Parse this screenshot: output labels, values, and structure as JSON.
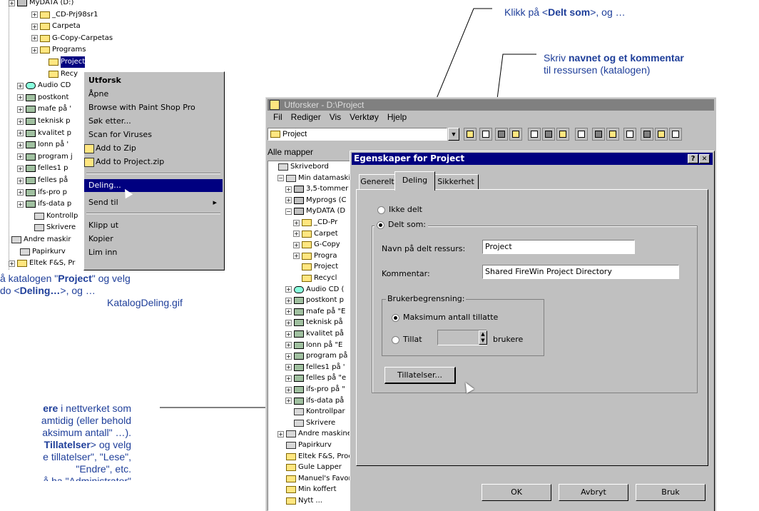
{
  "top_tree": {
    "items": [
      {
        "label": "MyDATA (D:)",
        "kind": "drv"
      },
      {
        "label": "_CD-Prj98sr1",
        "kind": "fold"
      },
      {
        "label": "Carpeta",
        "kind": "fold"
      },
      {
        "label": "G-Copy-Carpetas",
        "kind": "fold"
      },
      {
        "label": "Programs",
        "kind": "fold"
      },
      {
        "label": "Project",
        "kind": "fold"
      },
      {
        "label": "Recy",
        "kind": "fold"
      },
      {
        "label": "Audio CD",
        "kind": "cd"
      },
      {
        "label": "postkont",
        "kind": "net"
      },
      {
        "label": "mafe på '",
        "kind": "net"
      },
      {
        "label": "teknisk p",
        "kind": "net"
      },
      {
        "label": "kvalitet p",
        "kind": "net"
      },
      {
        "label": "lonn på '",
        "kind": "net"
      },
      {
        "label": "program j",
        "kind": "net"
      },
      {
        "label": "felles1 p",
        "kind": "net"
      },
      {
        "label": "felles på",
        "kind": "net"
      },
      {
        "label": "ifs-pro p",
        "kind": "net"
      },
      {
        "label": "ifs-data p",
        "kind": "net"
      },
      {
        "label": "Kontrollp",
        "kind": "pc"
      },
      {
        "label": "Skrivere",
        "kind": "pc"
      },
      {
        "label": "Andre maskir",
        "kind": "pc"
      },
      {
        "label": "Papirkurv",
        "kind": "pc"
      },
      {
        "label": "Eltek F&S, Pr",
        "kind": "fold"
      }
    ]
  },
  "context_menu": {
    "items": [
      {
        "label": "Utforsk",
        "bold": true
      },
      {
        "label": "Åpne"
      },
      {
        "label": "Browse with Paint Shop Pro"
      },
      {
        "label": "Søk etter..."
      },
      {
        "label": "Scan for Viruses"
      },
      {
        "label": "Add to Zip"
      },
      {
        "label": "Add to Project.zip"
      },
      {
        "label": "Deling...",
        "highlight": true
      },
      {
        "label": "Send til",
        "submenu": true
      },
      {
        "label": "Klipp ut"
      },
      {
        "label": "Kopier"
      },
      {
        "label": "Lim inn"
      }
    ],
    "submenu_arrow": "▸"
  },
  "annotations": {
    "a1_line1_pre": "å katalogen \"",
    "a1_line1_bold": "Project",
    "a1_line1_post": "\" og velg",
    "a1_line2_pre": "do <",
    "a1_line2_bold": "Deling…",
    "a1_line2_post": ">, og …",
    "a1_file": "KatalogDeling.gif",
    "a2_line1_bold": "ere",
    "a2_line1_post": " i nettverket som",
    "a2_line2": "amtidig (eller behold",
    "a2_line3": "aksimum antall\" …).",
    "a2_line4_bold": "Tillatelser",
    "a2_line4_post": "> og velg",
    "a2_line5": "e tillatelser\", \"Lese\",",
    "a2_line6": "\"Endre\", etc.",
    "a2_line7": "å ha \"Administrator\"",
    "top_right_pre": "Klikk på <",
    "top_right_bold": "Delt som",
    "top_right_post": ">, og …",
    "right_line1_pre": "Skriv ",
    "right_line1_bold": "navnet og et kommentar",
    "right_line2": "til ressursen (katalogen)"
  },
  "explorer": {
    "title": "Utforsker - D:\\Project",
    "menu": [
      "Fil",
      "Rediger",
      "Vis",
      "Verktøy",
      "Hjelp"
    ],
    "address": "Project",
    "tree_header": "Alle mapper",
    "tree": [
      {
        "label": "Skrivebord",
        "kind": "pc",
        "indent": 0
      },
      {
        "label": "Min datamaskin",
        "kind": "pc",
        "indent": 1
      },
      {
        "label": "3,5-tommer",
        "kind": "drv",
        "indent": 2
      },
      {
        "label": "Myprogs (C",
        "kind": "drv",
        "indent": 2
      },
      {
        "label": "MyDATA (D",
        "kind": "drv",
        "indent": 2
      },
      {
        "label": "_CD-Pr",
        "kind": "fold",
        "indent": 3
      },
      {
        "label": "Carpet",
        "kind": "fold",
        "indent": 3
      },
      {
        "label": "G-Copy",
        "kind": "fold",
        "indent": 3
      },
      {
        "label": "Progra",
        "kind": "fold",
        "indent": 3
      },
      {
        "label": "Project",
        "kind": "fold",
        "indent": 3
      },
      {
        "label": "Recycl",
        "kind": "fold",
        "indent": 3
      },
      {
        "label": "Audio CD (",
        "kind": "cd",
        "indent": 2
      },
      {
        "label": "postkont p",
        "kind": "net",
        "indent": 2
      },
      {
        "label": "mafe på \"E",
        "kind": "net",
        "indent": 2
      },
      {
        "label": "teknisk på",
        "kind": "net",
        "indent": 2
      },
      {
        "label": "kvalitet på",
        "kind": "net",
        "indent": 2
      },
      {
        "label": "lonn på \"E",
        "kind": "net",
        "indent": 2
      },
      {
        "label": "program på",
        "kind": "net",
        "indent": 2
      },
      {
        "label": "felles1 på '",
        "kind": "net",
        "indent": 2
      },
      {
        "label": "felles på \"e",
        "kind": "net",
        "indent": 2
      },
      {
        "label": "ifs-pro på \"",
        "kind": "net",
        "indent": 2
      },
      {
        "label": "ifs-data på",
        "kind": "net",
        "indent": 2
      },
      {
        "label": "Kontrollpar",
        "kind": "pc",
        "indent": 2
      },
      {
        "label": "Skrivere",
        "kind": "pc",
        "indent": 2
      },
      {
        "label": "Andre maskine",
        "kind": "pc",
        "indent": 1
      },
      {
        "label": "Papirkurv",
        "kind": "pc",
        "indent": 1
      },
      {
        "label": "Eltek F&S, Proc",
        "kind": "fold",
        "indent": 1
      },
      {
        "label": "Gule Lapper",
        "kind": "fold",
        "indent": 1
      },
      {
        "label": "Manuel's Favor",
        "kind": "fold",
        "indent": 1
      },
      {
        "label": "Min koffert",
        "kind": "fold",
        "indent": 1
      },
      {
        "label": "Nytt ...",
        "kind": "fold",
        "indent": 1
      }
    ]
  },
  "dialog": {
    "title": "Egenskaper for Project",
    "help_btn": "?",
    "close_btn": "✕",
    "tabs": [
      "Generelt",
      "Deling",
      "Sikkerhet"
    ],
    "not_shared": "Ikke delt",
    "shared_as": "Delt som:",
    "share_name_label": "Navn på delt ressurs:",
    "share_name_value": "Project",
    "comment_label": "Kommentar:",
    "comment_value": "Shared FireWin Project Directory",
    "user_limit_group": "Brukerbegrensning:",
    "max_allowed": "Maksimum antall tillatte",
    "allow": "Tillat",
    "users": "brukere",
    "permissions_btn": "Tillatelser...",
    "ok": "OK",
    "cancel": "Avbryt",
    "apply": "Bruk"
  }
}
